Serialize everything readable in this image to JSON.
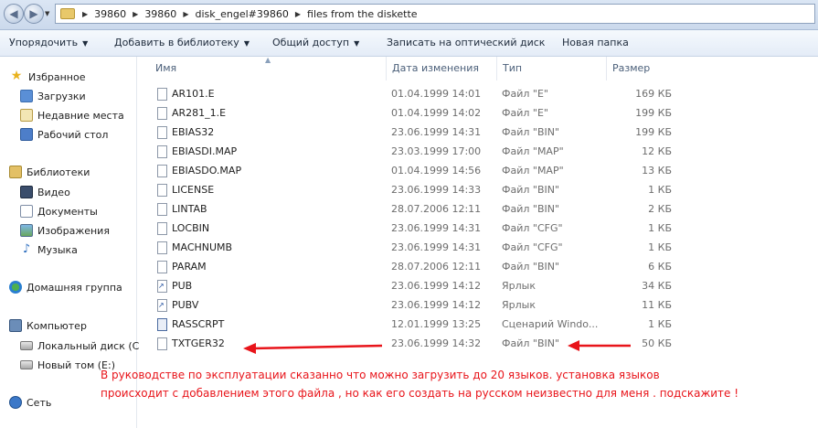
{
  "address": {
    "crumbs": [
      "39860",
      "39860",
      "disk_engel#39860",
      "files from the diskette"
    ]
  },
  "toolbar": {
    "organize": "Упорядочить",
    "add_to_library": "Добавить в библиотеку",
    "share": "Общий доступ",
    "burn": "Записать на оптический диск",
    "new_folder": "Новая папка"
  },
  "nav": {
    "favorites": "Избранное",
    "downloads": "Загрузки",
    "recent": "Недавние места",
    "desktop": "Рабочий стол",
    "libraries": "Библиотеки",
    "video": "Видео",
    "documents": "Документы",
    "images": "Изображения",
    "music": "Музыка",
    "homegroup": "Домашняя группа",
    "computer": "Компьютер",
    "local_disk": "Локальный диск (C",
    "new_volume": "Новый том (E:)",
    "network": "Сеть"
  },
  "columns": {
    "name": "Имя",
    "date": "Дата изменения",
    "type": "Тип",
    "size": "Размер"
  },
  "files": [
    {
      "name": "AR101.E",
      "date": "01.04.1999 14:01",
      "type": "Файл \"E\"",
      "size": "169 КБ",
      "icon": "file-icon"
    },
    {
      "name": "AR281_1.E",
      "date": "01.04.1999 14:02",
      "type": "Файл \"E\"",
      "size": "199 КБ",
      "icon": "file-icon"
    },
    {
      "name": "EBIAS32",
      "date": "23.06.1999 14:31",
      "type": "Файл \"BIN\"",
      "size": "199 КБ",
      "icon": "file-icon"
    },
    {
      "name": "EBIASDI.MAP",
      "date": "23.03.1999 17:00",
      "type": "Файл \"MAP\"",
      "size": "12 КБ",
      "icon": "file-icon"
    },
    {
      "name": "EBIASDO.MAP",
      "date": "01.04.1999 14:56",
      "type": "Файл \"MAP\"",
      "size": "13 КБ",
      "icon": "file-icon"
    },
    {
      "name": "LICENSE",
      "date": "23.06.1999 14:33",
      "type": "Файл \"BIN\"",
      "size": "1 КБ",
      "icon": "file-icon"
    },
    {
      "name": "LINTAB",
      "date": "28.07.2006 12:11",
      "type": "Файл \"BIN\"",
      "size": "2 КБ",
      "icon": "file-icon"
    },
    {
      "name": "LOCBIN",
      "date": "23.06.1999 14:31",
      "type": "Файл \"CFG\"",
      "size": "1 КБ",
      "icon": "file-icon"
    },
    {
      "name": "MACHNUMB",
      "date": "23.06.1999 14:31",
      "type": "Файл \"CFG\"",
      "size": "1 КБ",
      "icon": "file-icon"
    },
    {
      "name": "PARAM",
      "date": "28.07.2006 12:11",
      "type": "Файл \"BIN\"",
      "size": "6 КБ",
      "icon": "file-icon"
    },
    {
      "name": "PUB",
      "date": "23.06.1999 14:12",
      "type": "Ярлык",
      "size": "34 КБ",
      "icon": "shortcut-icon"
    },
    {
      "name": "PUBV",
      "date": "23.06.1999 14:12",
      "type": "Ярлык",
      "size": "11 КБ",
      "icon": "shortcut-icon"
    },
    {
      "name": "RASSCRPT",
      "date": "12.01.1999 13:25",
      "type": "Сценарий Windo...",
      "size": "1 КБ",
      "icon": "script-icon"
    },
    {
      "name": "TXTGER32",
      "date": "23.06.1999 14:32",
      "type": "Файл \"BIN\"",
      "size": "50 КБ",
      "icon": "file-icon"
    }
  ],
  "annotation": {
    "line1": "В руководстве по эксплуатации сказанно что можно загрузить до 20 языков.  установка языков",
    "line2": "происходит с добавлением этого файла , но как его создать на русском неизвестно для меня . подскажите !",
    "color": "#e8141a"
  }
}
